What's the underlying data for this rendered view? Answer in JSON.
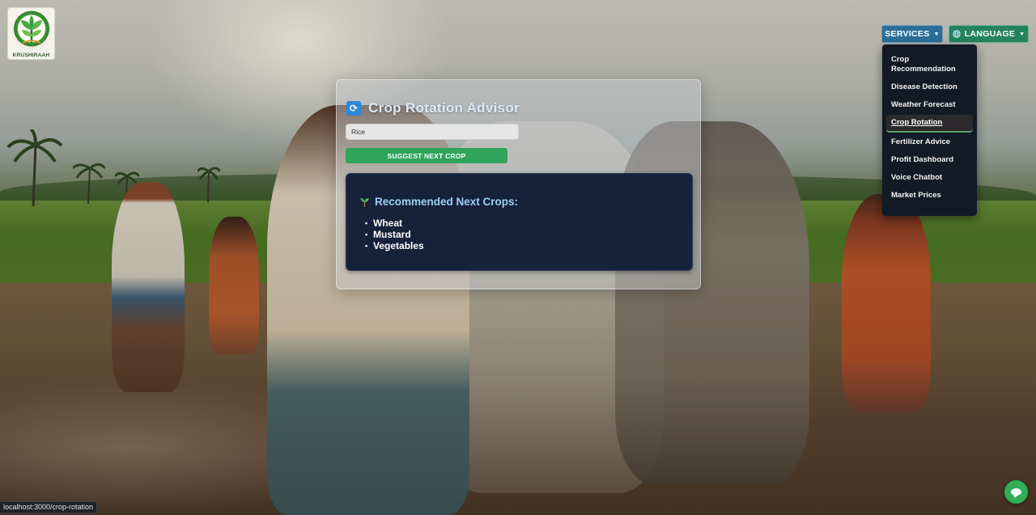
{
  "app": {
    "logo_text": "KRUSHIRAAH"
  },
  "nav": {
    "services_label": "SERVICES",
    "language_label": "LANGUAGE",
    "services_items": [
      "Crop Recommendation",
      "Disease Detection",
      "Weather Forecast",
      "Crop Rotation",
      "Fertilizer Advice",
      "Profit Dashboard",
      "Voice Chatbot",
      "Market Prices"
    ],
    "active_item": "Crop Rotation"
  },
  "advisor": {
    "title": "Crop Rotation Advisor",
    "input_value": "Rice",
    "submit_label": "SUGGEST NEXT CROP",
    "result_heading": "Recommended Next Crops:",
    "crops": [
      "Wheat",
      "Mustard",
      "Vegetables"
    ]
  },
  "status": {
    "url": "localhost:3000/crop-rotation"
  },
  "colors": {
    "services_button": "#2b6f98",
    "language_button": "#23835f",
    "submit_button": "#2ea55a",
    "result_panel": "#16213a",
    "result_heading": "#9fd0f4",
    "dropdown_bg": "#121a26"
  },
  "icons": {
    "title": "refresh-cycle-icon",
    "result": "seedling-icon",
    "language": "globe-icon",
    "fab": "chat-bubble-icon"
  }
}
